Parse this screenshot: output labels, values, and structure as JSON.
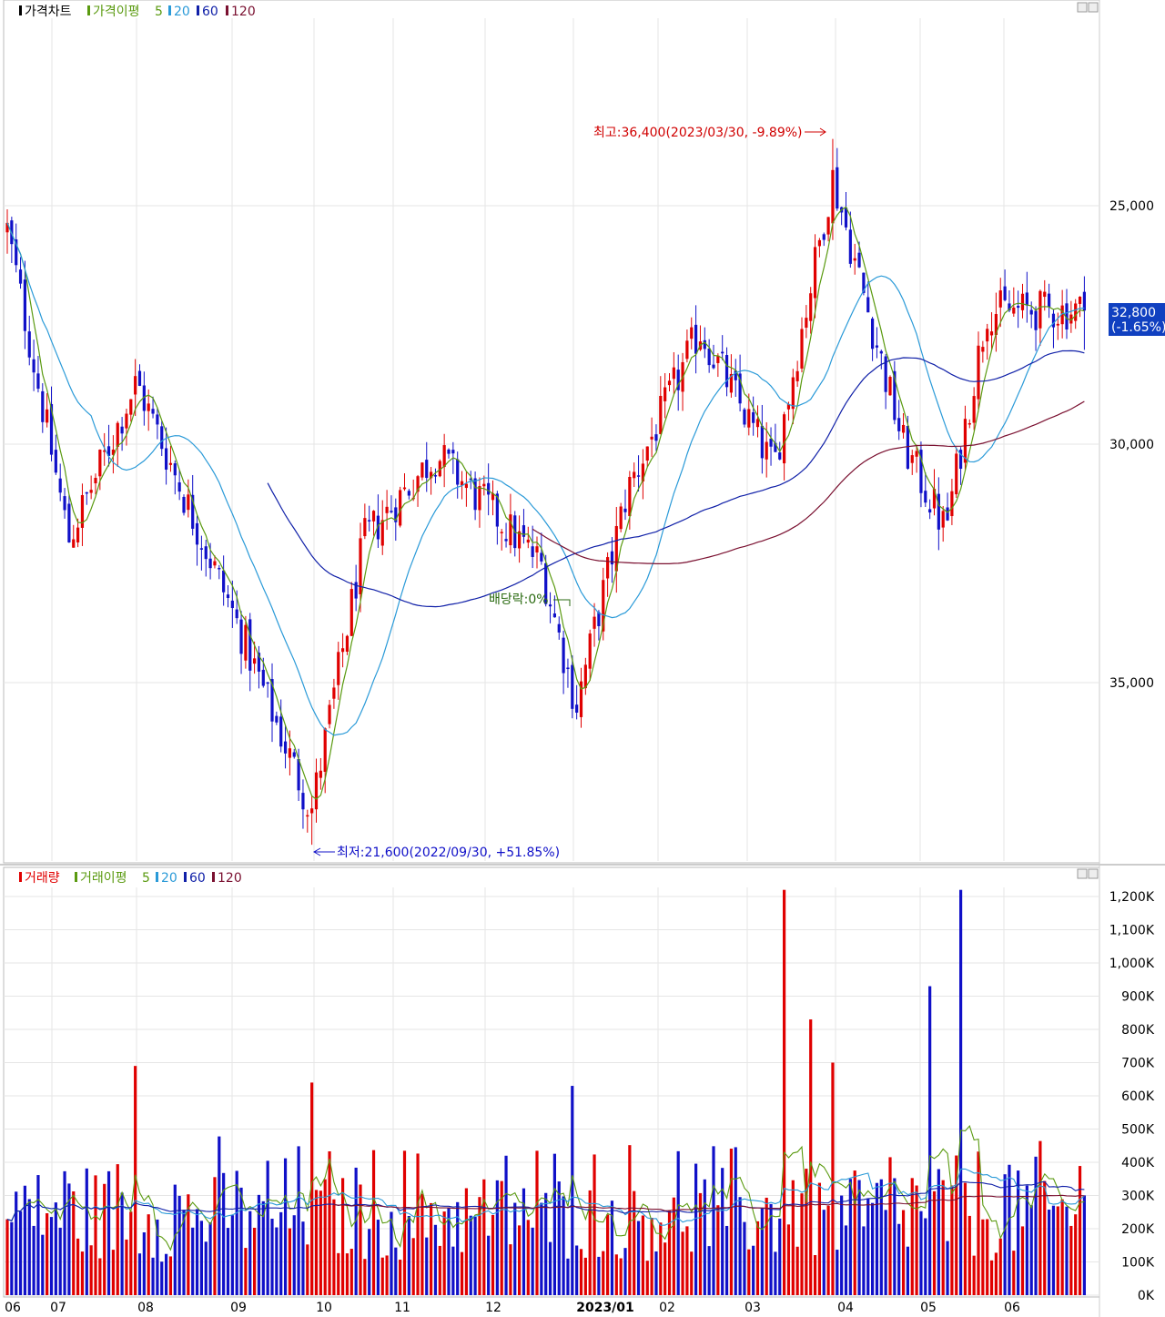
{
  "colors": {
    "up": "#e00000",
    "down": "#1010c8",
    "ma5": "#5a9a10",
    "ma20": "#2a9ad8",
    "ma60": "#1020a8",
    "ma120": "#7a1030",
    "grid": "#e6e6e6",
    "axis": "#888888"
  },
  "price_panel": {
    "title": "가격차트",
    "ma_label": "가격이평",
    "ma_periods": [
      "5",
      "20",
      "60",
      "120"
    ],
    "current_price": "32,800",
    "current_change": "(-1.65%)",
    "y_ticks": [
      "35,000",
      "30,000",
      "25,000"
    ],
    "high_annotation": "최고:36,400(2023/03/30, -9.89%)",
    "low_annotation": "최저:21,600(2022/09/30, +51.85%)",
    "dividend_annotation": "배당락:0%"
  },
  "volume_panel": {
    "title": "거래량",
    "ma_label": "거래이평",
    "ma_periods": [
      "5",
      "20",
      "60",
      "120"
    ],
    "y_ticks": [
      "1,200K",
      "1,100K",
      "1,000K",
      "900K",
      "800K",
      "700K",
      "600K",
      "500K",
      "400K",
      "300K",
      "200K",
      "100K",
      "0K"
    ]
  },
  "x_labels": [
    "06",
    "07",
    "08",
    "09",
    "10",
    "11",
    "12",
    "2023/01",
    "02",
    "03",
    "04",
    "05",
    "06"
  ],
  "chart_data": [
    {
      "type": "candlestick",
      "title": "가격차트",
      "x_start": "2022/06",
      "x_end": "2023/06",
      "ylim": [
        21000,
        37000
      ],
      "y_ticks": [
        25000,
        30000,
        35000
      ],
      "key_prices": [
        {
          "date": "2022/06",
          "close": 34500
        },
        {
          "date": "2022/07/07",
          "close": 28000
        },
        {
          "date": "2022/08/01",
          "close": 31300
        },
        {
          "date": "2022/08/31",
          "close": 26500
        },
        {
          "date": "2022/09/30",
          "low": 21600,
          "label": "최저"
        },
        {
          "date": "2022/10/20",
          "close": 28000
        },
        {
          "date": "2022/11/15",
          "close": 29800
        },
        {
          "date": "2022/12/20",
          "close": 27500
        },
        {
          "date": "2023/01/02",
          "close": 24500
        },
        {
          "date": "2023/01/20",
          "close": 29000
        },
        {
          "date": "2023/02/15",
          "close": 32400
        },
        {
          "date": "2023/03/10",
          "close": 29500
        },
        {
          "date": "2023/03/30",
          "high": 36400,
          "label": "최고"
        },
        {
          "date": "2023/04/25",
          "close": 30000
        },
        {
          "date": "2023/05/10",
          "close": 28200
        },
        {
          "date": "2023/05/25",
          "close": 32800
        },
        {
          "date": "2023/06/30",
          "close": 32800
        }
      ],
      "last_close": 32800,
      "last_change_pct": -1.65,
      "moving_averages": [
        5,
        20,
        60,
        120
      ]
    },
    {
      "type": "bar",
      "title": "거래량",
      "ylim": [
        0,
        1250000
      ],
      "y_ticks": [
        0,
        100000,
        200000,
        300000,
        400000,
        500000,
        600000,
        700000,
        800000,
        900000,
        1000000,
        1100000,
        1200000
      ],
      "notable_volumes": [
        {
          "date": "2022/08",
          "value": 690000
        },
        {
          "date": "2022/10",
          "value": 640000
        },
        {
          "date": "2023/01",
          "value": 630000
        },
        {
          "date": "2023/03/13",
          "value": 1220000
        },
        {
          "date": "2023/03/22",
          "value": 830000
        },
        {
          "date": "2023/03/30",
          "value": 700000
        },
        {
          "date": "2023/05/05",
          "value": 930000
        },
        {
          "date": "2023/05/15",
          "value": 1220000
        }
      ],
      "typical_range": [
        100000,
        500000
      ],
      "moving_averages": [
        5,
        20,
        60,
        120
      ]
    }
  ]
}
